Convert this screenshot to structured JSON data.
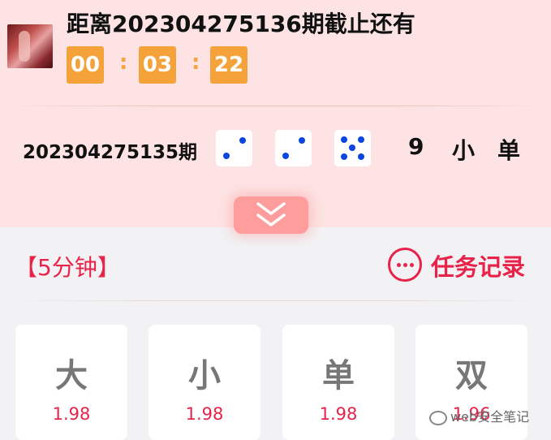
{
  "header": {
    "avatar_icon": "lottery-thumbnail-image",
    "title": "距离202304275136期截止还有",
    "countdown": {
      "hours": "00",
      "minutes": "03",
      "seconds": "22",
      "separator": ":"
    }
  },
  "last_result": {
    "period": "202304275135期",
    "dice": [
      2,
      2,
      5
    ],
    "sum": "9",
    "size": "小",
    "parity": "单"
  },
  "expand_icon": "double-chevron-down-icon",
  "section": {
    "title": "【5分钟】",
    "task_icon": "more-dots-circle-icon",
    "task_label": "任务记录"
  },
  "bet_options": [
    {
      "name": "大",
      "odds": "1.98"
    },
    {
      "name": "小",
      "odds": "1.98"
    },
    {
      "name": "单",
      "odds": "1.98"
    },
    {
      "name": "双",
      "odds": "1.96"
    }
  ],
  "watermark": "web安全笔记",
  "colors": {
    "accent": "#e8234a",
    "countdown": "#f5a23a",
    "pip": "#0a45e0",
    "header_bg": "#fde3e3"
  }
}
